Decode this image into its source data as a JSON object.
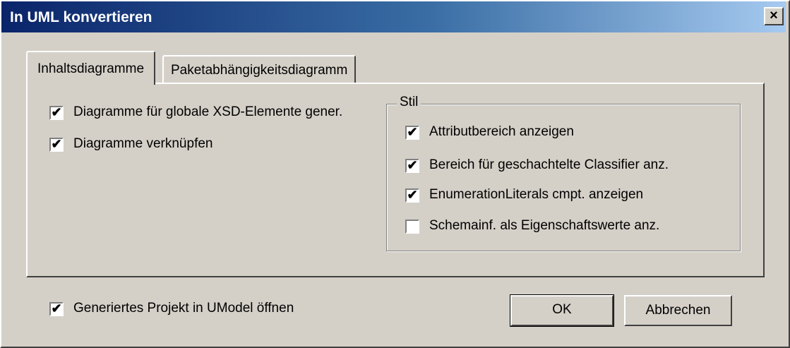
{
  "window": {
    "title": "In UML konvertieren",
    "close_label": "×"
  },
  "tabs": [
    {
      "label": "Inhaltsdiagramme",
      "active": true
    },
    {
      "label": "Paketabhängigkeitsdiagramm",
      "active": false
    }
  ],
  "content_options": [
    {
      "label": "Diagramme für globale XSD-Elemente gener.",
      "checked": true
    },
    {
      "label": "Diagramme verknüpfen",
      "checked": true
    }
  ],
  "style_group": {
    "legend": "Stil",
    "options": [
      {
        "label": "Attributbereich anzeigen",
        "checked": true
      },
      {
        "label": "Bereich für geschachtelte Classifier anz.",
        "checked": true
      },
      {
        "label": "EnumerationLiterals cmpt. anzeigen",
        "checked": true
      },
      {
        "label": "Schemainf. als Eigenschaftswerte anz.",
        "checked": false
      }
    ]
  },
  "open_project": {
    "label": "Generiertes Projekt in UModel öffnen",
    "checked": true
  },
  "buttons": {
    "ok": "OK",
    "cancel": "Abbrechen"
  },
  "check_mark": "✔",
  "colors": {
    "dialog_bg": "#d4d0c8",
    "title_start": "#0a246a",
    "title_end": "#a6caf0"
  }
}
